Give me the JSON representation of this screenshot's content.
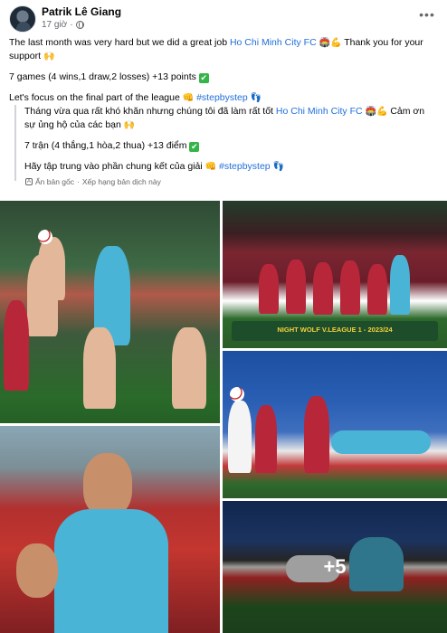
{
  "post": {
    "author": "Patrik Lê Giang",
    "time": "17 giờ",
    "separator": "·",
    "line1_pre": "The last month was very hard but we did a great job ",
    "line1_link": "Ho Chi Minh City FC",
    "line1_emoji": "🏟️💪",
    "line1_post": " Thank you for your support ",
    "line1_end_emoji": "🙌",
    "line2": "7 games (4 wins,1 draw,2 losses) +13 points ",
    "line2_check": "✔",
    "line3_pre": "Let's focus on the final part of the league ",
    "line3_emoji": "👊",
    "line3_tag": "#stepbystep",
    "line3_end_emoji": "👣"
  },
  "translation": {
    "line1_pre": "Tháng vừa qua rất khó khăn nhưng chúng tôi đã làm rất tốt ",
    "line1_link": "Ho Chi Minh City FC",
    "line1_emoji": "🏟️💪",
    "line1_post": " Cảm ơn sự ủng hộ của các bạn ",
    "line1_end_emoji": "🙌",
    "line2": "7 trận (4 thắng,1 hòa,2 thua) +13 điểm ",
    "line2_check": "✔",
    "line3_pre": "Hãy tập trung vào phần chung kết của giải ",
    "line3_emoji": "👊",
    "line3_tag": "#stepbystep",
    "line3_end_emoji": "👣",
    "hide_original": "Ẩn bản gốc",
    "dot": "·",
    "rate": "Xếp hạng bản dịch này"
  },
  "gallery": {
    "banner_text": "NIGHT WOLF V.LEAGUE 1 - 2023/24",
    "more_count": "+5"
  },
  "icons": {
    "more": "more-horizontal-icon",
    "globe": "globe-icon",
    "translate": "translate-icon"
  },
  "colors": {
    "link": "#216fdb",
    "meta": "#65676b",
    "check": "#35b449"
  }
}
